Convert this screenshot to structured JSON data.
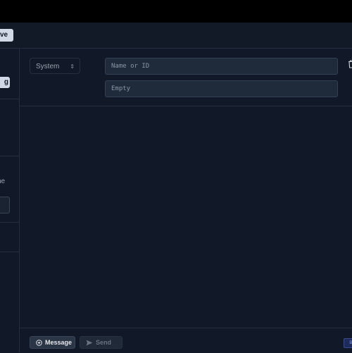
{
  "toolbar": {
    "save_label": "ve"
  },
  "sidebar": {
    "badge_label": "g",
    "text_fragment": "he"
  },
  "message": {
    "role": "System",
    "name_placeholder": "Name or ID",
    "content_placeholder": "Empty"
  },
  "footer": {
    "add_message_label": "Message",
    "send_label": "Send",
    "corner_badge": "Bi"
  },
  "colors": {
    "background": "#111827",
    "border": "#243042",
    "field": "#1f2a3a",
    "button_light": "#d1d9e6"
  }
}
